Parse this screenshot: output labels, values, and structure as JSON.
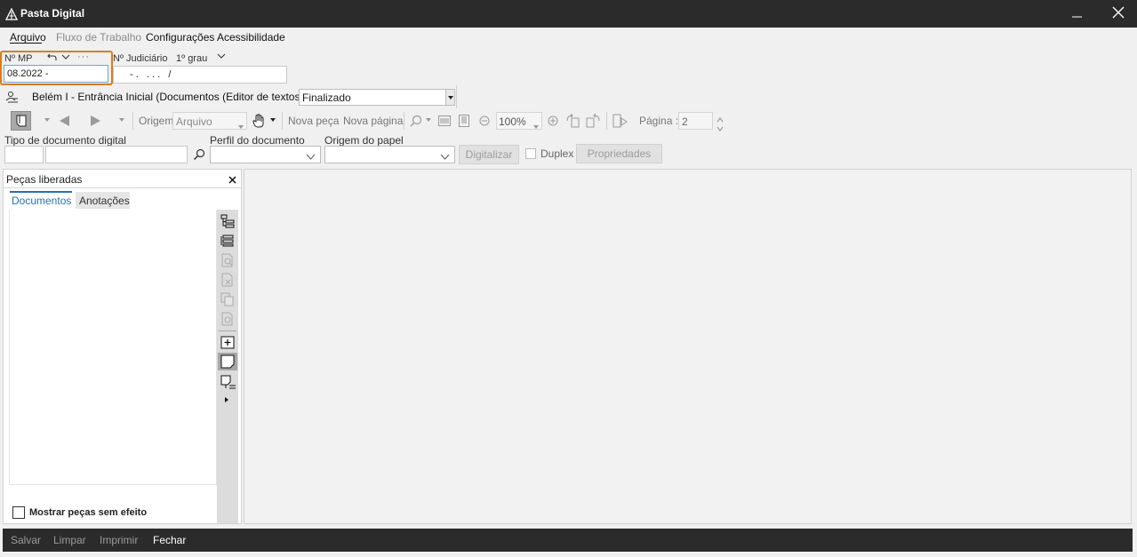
{
  "window": {
    "title": "Pasta Digital",
    "minimize_icon": "minimize-icon",
    "close_icon": "close-icon"
  },
  "menu": {
    "arquivo": "Arquivo",
    "fluxo": "Fluxo de Trabalho",
    "configuracoes": "Configurações",
    "acessibilidade": "Acessibilidade"
  },
  "header": {
    "mp_label": "Nº MP",
    "mp_value": "08.2022 -",
    "judiciario_label": "Nº Judiciário",
    "grau_label": "1º grau",
    "judiciario_value": "- .   . . .   /",
    "fila_text": "Belém I - Entrância Inicial (Documentos (Editor de textos)) - Fila",
    "fila_value": "Finalizado",
    "highlight_color": "#e07b12"
  },
  "toolbar": {
    "origem_label": "Origem",
    "origem_value": "Arquivo",
    "nova_peca": "Nova peça",
    "nova_pagina": "Nova página",
    "zoom": "100%",
    "pagina_label": "Página :",
    "pagina_value": "2"
  },
  "docrow": {
    "tipo_label": "Tipo de documento digital",
    "perfil_label": "Perfil do documento",
    "origem_papel_label": "Origem do papel",
    "digitalizar": "Digitalizar",
    "duplex": "Duplex",
    "propriedades": "Propriedades"
  },
  "panel": {
    "title": "Peças liberadas",
    "tabs": [
      {
        "label": "Documentos",
        "active": true
      },
      {
        "label": "Anotações",
        "active": false
      }
    ],
    "mostrar": "Mostrar peças sem efeito"
  },
  "bottom": {
    "salvar": "Salvar",
    "limpar": "Limpar",
    "imprimir": "Imprimir",
    "fechar": "Fechar"
  }
}
